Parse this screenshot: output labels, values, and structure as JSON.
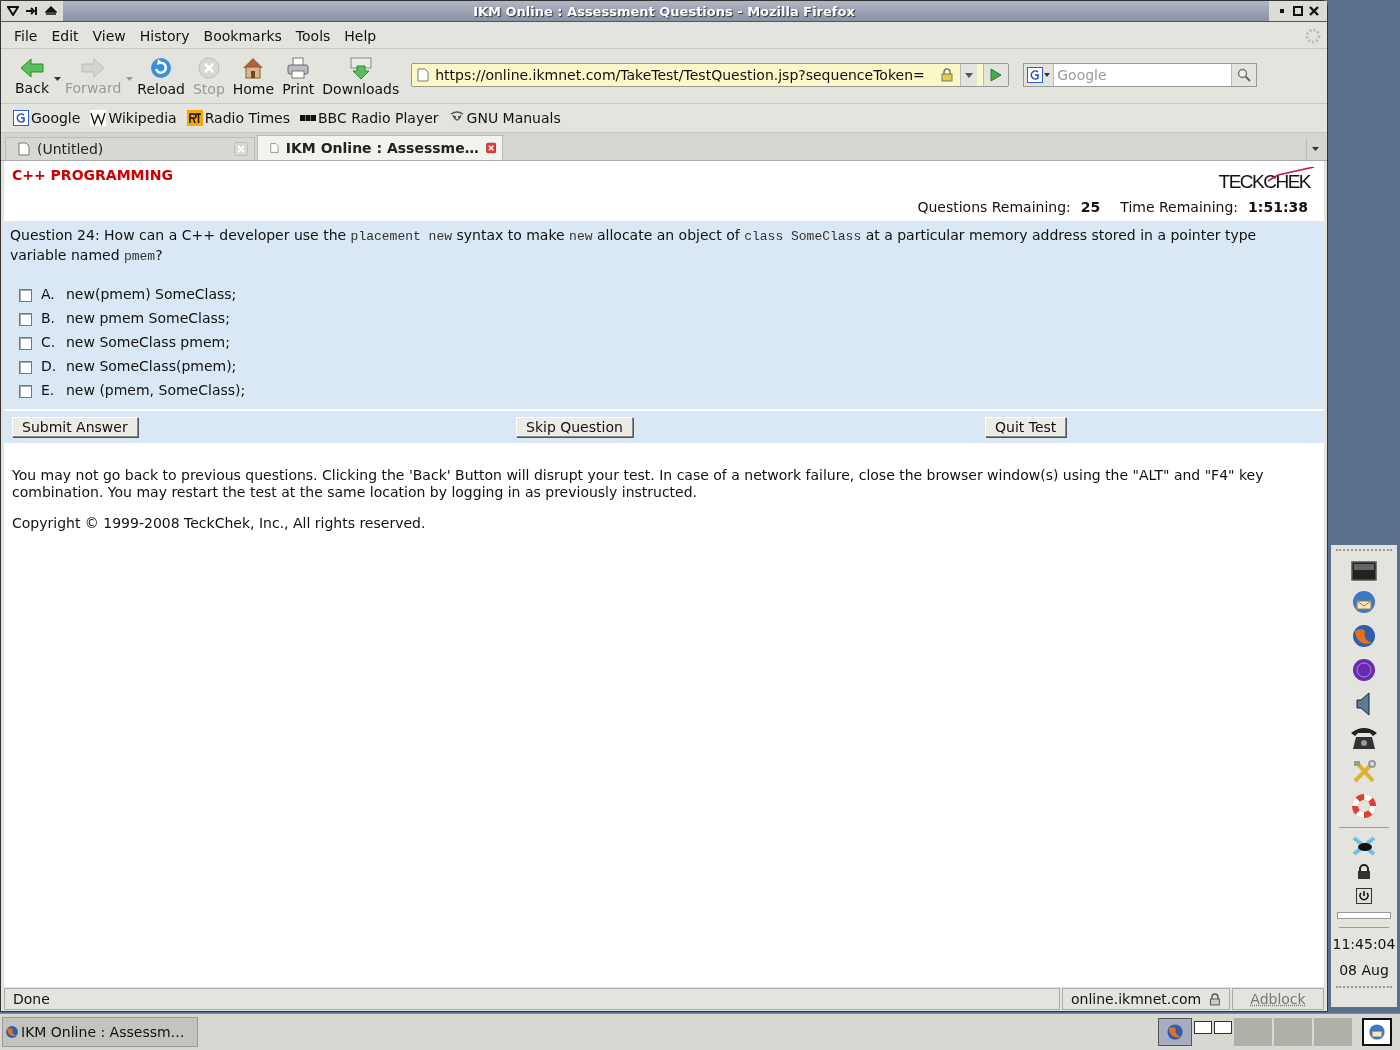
{
  "window": {
    "title": "IKM Online : Assessment Questions - Mozilla Firefox"
  },
  "menu": [
    "File",
    "Edit",
    "View",
    "History",
    "Bookmarks",
    "Tools",
    "Help"
  ],
  "toolbar": [
    {
      "kind": "back",
      "label": "Back",
      "disabled": false,
      "dropdown": true
    },
    {
      "kind": "forward",
      "label": "Forward",
      "disabled": true,
      "dropdown": true
    },
    {
      "kind": "reload",
      "label": "Reload",
      "disabled": false,
      "dropdown": false
    },
    {
      "kind": "stop",
      "label": "Stop",
      "disabled": true,
      "dropdown": false
    },
    {
      "kind": "home",
      "label": "Home",
      "disabled": false,
      "dropdown": false
    },
    {
      "kind": "print",
      "label": "Print",
      "disabled": false,
      "dropdown": false
    },
    {
      "kind": "downloads",
      "label": "Downloads",
      "disabled": false,
      "dropdown": false
    }
  ],
  "address_bar": {
    "value": "https://online.ikmnet.com/TakeTest/TestQuestion.jsp?sequenceToken="
  },
  "search": {
    "placeholder": "Google"
  },
  "bookmarks": [
    {
      "kind": "google",
      "label": "Google"
    },
    {
      "kind": "wiki",
      "label": "Wikipedia"
    },
    {
      "kind": "rt",
      "label": "Radio Times"
    },
    {
      "kind": "bbc",
      "label": "BBC Radio Player"
    },
    {
      "kind": "gnu",
      "label": "GNU Manuals"
    }
  ],
  "tabs": [
    {
      "label": "(Untitled)",
      "selected": false
    },
    {
      "label": "IKM Online : Assessme…",
      "selected": true
    }
  ],
  "page": {
    "heading": "C++ PROGRAMMING",
    "logo": "TECKCHEK",
    "stats": [
      {
        "label": "Questions Remaining:",
        "value": "25"
      },
      {
        "label": "Time Remaining:",
        "value": "1:51:38"
      }
    ],
    "question": [
      {
        "kind": "text",
        "text": "Question 24: How can a C++ developer use the "
      },
      {
        "kind": "code",
        "text": "placement new"
      },
      {
        "kind": "text",
        "text": " syntax to make "
      },
      {
        "kind": "code",
        "text": "new"
      },
      {
        "kind": "text",
        "text": " allocate an object of "
      },
      {
        "kind": "code",
        "text": "class SomeClass"
      },
      {
        "kind": "text",
        "text": " at a particular memory address stored in a pointer type variable named "
      },
      {
        "kind": "code",
        "text": "pmem"
      },
      {
        "kind": "text",
        "text": "?"
      }
    ],
    "options": [
      {
        "letter": "A.",
        "text": "new(pmem) SomeClass;",
        "checked": false
      },
      {
        "letter": "B.",
        "text": "new pmem SomeClass;",
        "checked": false
      },
      {
        "letter": "C.",
        "text": "new SomeClass pmem;",
        "checked": false
      },
      {
        "letter": "D.",
        "text": "new SomeClass(pmem);",
        "checked": false
      },
      {
        "letter": "E.",
        "text": "new (pmem, SomeClass);",
        "checked": false
      }
    ],
    "buttons": [
      "Submit Answer",
      "Skip Question",
      "Quit Test"
    ],
    "notice": "You may not go back to previous questions. Clicking the 'Back' Button will disrupt your test. In case of a network failure, close the browser window(s) using the \"ALT\" and \"F4\" key combination. You may restart the test at the same location by logging in as previously instructed.",
    "copyright": "Copyright © 1999-2008 TeckChek, Inc., All rights reserved."
  },
  "status_bar": {
    "text": "Done",
    "domain": "online.ikmnet.com",
    "adblock": "Adblock"
  },
  "panel": {
    "time": "11:45:04",
    "date": "08 Aug"
  },
  "taskbar": {
    "task": "IKM Online : Assessm…"
  }
}
